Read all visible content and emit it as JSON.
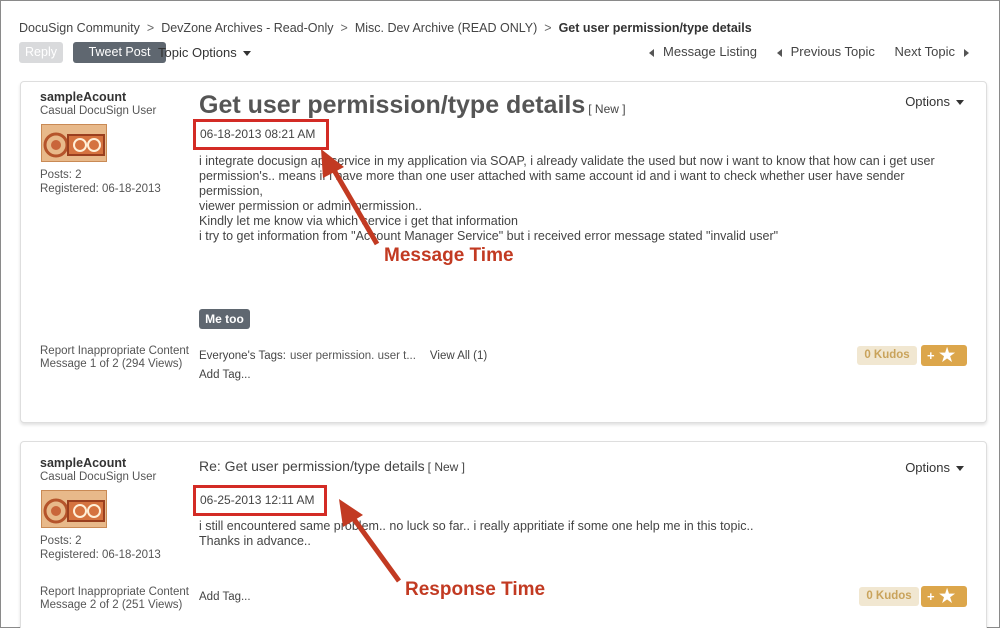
{
  "breadcrumb": {
    "items": [
      "DocuSign Community",
      "DevZone Archives - Read-Only",
      "Misc. Dev Archive (READ ONLY)"
    ],
    "current": "Get user permission/type details"
  },
  "toolbar": {
    "reply_label": "Reply",
    "tweet_label": "Tweet Post",
    "topic_options_label": "Topic Options"
  },
  "nav": {
    "message_listing": "Message Listing",
    "previous_topic": "Previous Topic",
    "next_topic": "Next Topic"
  },
  "posts": [
    {
      "author": "sampleAcount",
      "rank": "Casual DocuSign User",
      "posts": "Posts: 2",
      "registered": "Registered: 06-18-2013",
      "subject": "Get user permission/type details",
      "new_tag": "[ New ]",
      "options_label": "Options",
      "timestamp": "06-18-2013 08:21 AM",
      "body": [
        "i integrate docusign api service in my application via SOAP, i already validate the used but now i want to know that how can i get user",
        "permission's.. means if i have more than one user attached with same account id and i want to check whether user have sender permission,",
        "viewer permission or admin permission..",
        "Kindly let me know via which service i get that information",
        "i try to get information from \"Account Manager Service\" but i received error message stated \"invalid user\""
      ],
      "me_too_label": "Me too",
      "report_label": "Report Inappropriate Content",
      "message_count": "Message 1 of 2 (294 Views)",
      "tags_label": "Everyone's Tags:",
      "tags_value": "user permission. user t...",
      "view_all": "View All (1)",
      "add_tag": "Add Tag...",
      "kudos_label": "0 Kudos",
      "kudo_plus": "+"
    },
    {
      "author": "sampleAcount",
      "rank": "Casual DocuSign User",
      "posts": "Posts: 2",
      "registered": "Registered: 06-18-2013",
      "subject": "Re: Get user permission/type details",
      "new_tag": "[ New ]",
      "options_label": "Options",
      "timestamp": "06-25-2013 12:11 AM",
      "body": [
        "i still encountered same problem.. no luck so far.. i really appritiate if some one help me in this topic..",
        "Thanks in advance.."
      ],
      "report_label": "Report Inappropriate Content",
      "message_count": "Message 2 of 2 (251 Views)",
      "add_tag": "Add Tag...",
      "kudos_label": "0 Kudos",
      "kudo_plus": "+"
    }
  ],
  "annotations": {
    "message_time": "Message Time",
    "response_time": "Response Time",
    "color": "#c23a22"
  },
  "icons": {
    "star": "star-icon",
    "caret": "chevron-down-icon",
    "left_arrow": "triangle-left-icon",
    "right_arrow": "triangle-right-icon"
  }
}
